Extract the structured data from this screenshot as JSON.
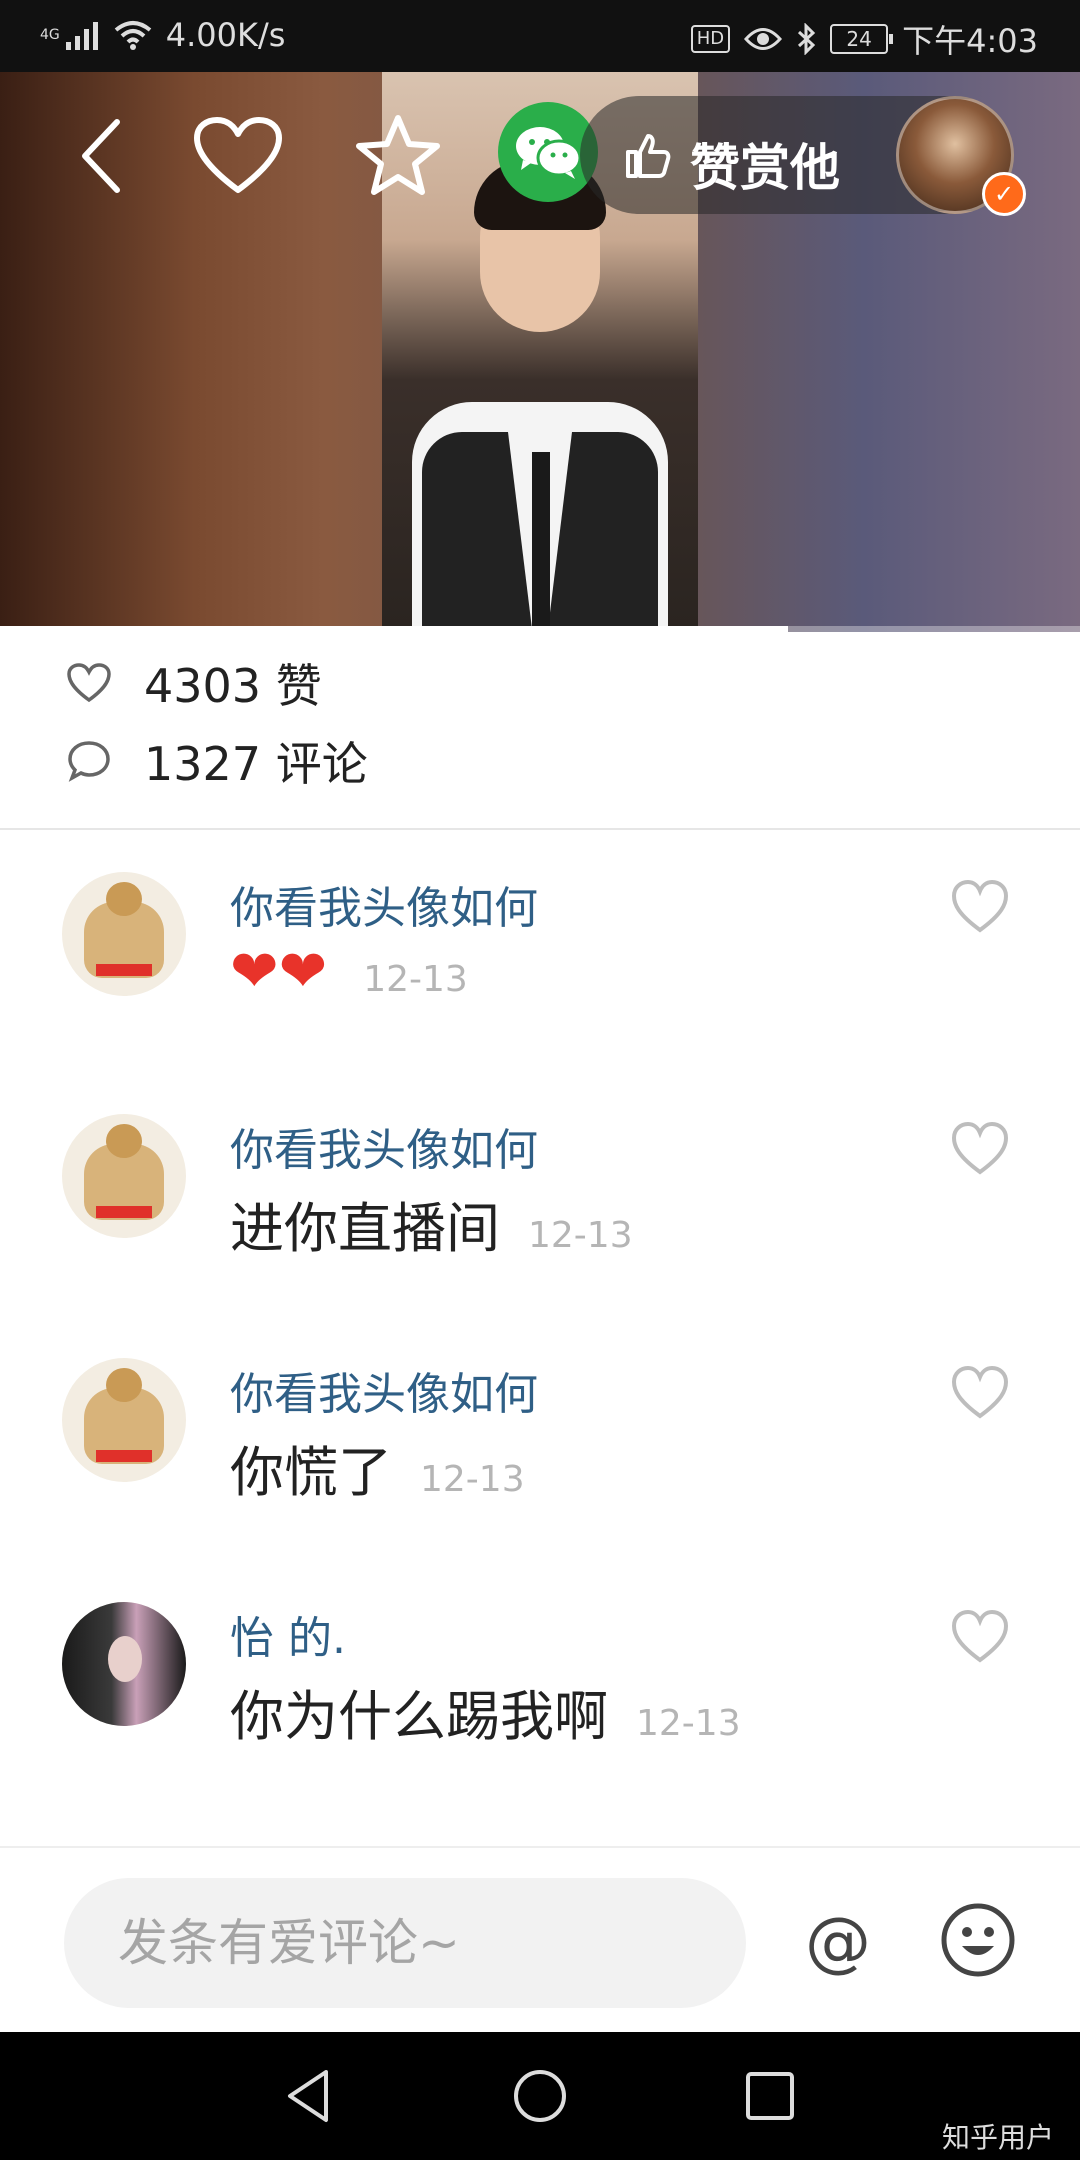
{
  "status_bar": {
    "network": "4G",
    "speed": "4.00K/s",
    "hd_badge": "HD",
    "battery": "24",
    "time": "下午4:03"
  },
  "video": {
    "reward_label": "赞赏他",
    "progress": 0.73
  },
  "stats": {
    "likes": "4303 赞",
    "comments": "1327 评论"
  },
  "comments": [
    {
      "name": "你看我头像如何",
      "text": "",
      "emoji": "❤❤",
      "date": "12-13"
    },
    {
      "name": "你看我头像如何",
      "text": "进你直播间",
      "date": "12-13"
    },
    {
      "name": "你看我头像如何",
      "text": "你慌了",
      "date": "12-13"
    },
    {
      "name": "怡 的.",
      "text": "你为什么踢我啊",
      "date": "12-13"
    }
  ],
  "input": {
    "placeholder": "发条有爱评论~",
    "at_symbol": "@"
  },
  "watermark": "知乎用户"
}
